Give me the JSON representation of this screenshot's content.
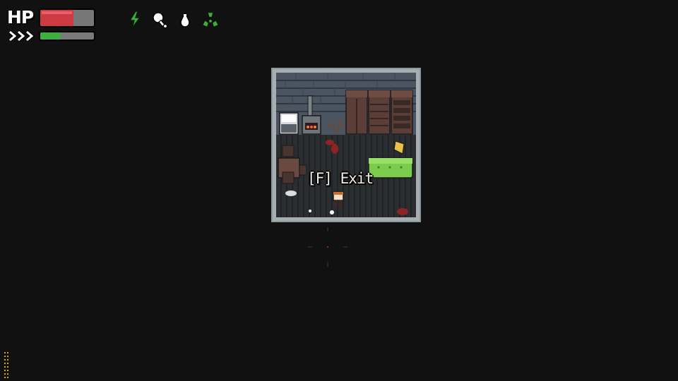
{
  "hud": {
    "hp_label": "HP",
    "hp_fraction": 0.62,
    "stamina_fraction": 0.38,
    "hp_color": "#cf3b43",
    "hp_empty_color": "#777777",
    "stamina_color": "#3fae3f",
    "speed_icon": "triple-chevron-icon",
    "status_icons": [
      {
        "name": "energy-lightning-icon",
        "color": "#3fae3f"
      },
      {
        "name": "food-drumstick-icon",
        "color": "#ffffff"
      },
      {
        "name": "water-drop-icon",
        "color": "#ffffff"
      },
      {
        "name": "radiation-icon",
        "color": "#3fae3f"
      }
    ]
  },
  "scene": {
    "interact_prompt": "[F] Exit",
    "room_items": [
      "stove",
      "fridge",
      "wardrobe",
      "dresser",
      "bookshelf",
      "table",
      "chairs",
      "sofa",
      "player",
      "blood-stains",
      "dead-bush",
      "sticky-note"
    ]
  },
  "colors": {
    "background": "#111111",
    "room_wall": "#9aa3a8",
    "floor": "#2d2f32",
    "sofa": "#7bcb4c",
    "blood": "#8e2326"
  }
}
